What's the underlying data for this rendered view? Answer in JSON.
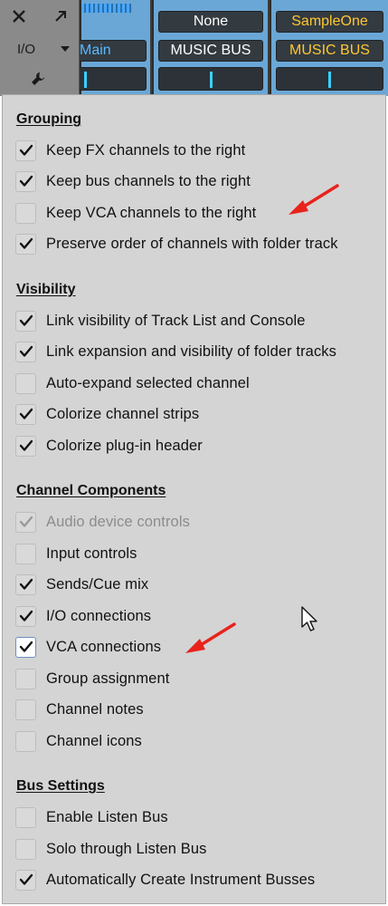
{
  "console": {
    "controls": {
      "close_icon": "close-x-icon",
      "expand_icon": "diagonal-arrow-icon",
      "io_label": "I/O",
      "io_arrow_icon": "triangle-down-icon",
      "wrench_icon": "wrench-icon"
    },
    "strips": [
      {
        "slot_b": "Main",
        "slot_b_color": "#5ab8ff"
      },
      {
        "slot_a": "None",
        "slot_b": "MUSIC BUS"
      },
      {
        "slot_a": "SampleOne",
        "slot_b": "MUSIC BUS",
        "accent": "#ffc832"
      }
    ]
  },
  "menu": {
    "sections": [
      {
        "title": "Grouping",
        "items": [
          {
            "label": "Keep FX channels to the right",
            "checked": true
          },
          {
            "label": "Keep bus channels to the right",
            "checked": true
          },
          {
            "label": "Keep VCA channels to the right",
            "checked": false
          },
          {
            "label": "Preserve order of channels with folder track",
            "checked": true
          }
        ]
      },
      {
        "title": "Visibility",
        "items": [
          {
            "label": "Link visibility of Track List and Console",
            "checked": true
          },
          {
            "label": "Link expansion and visibility of folder tracks",
            "checked": true
          },
          {
            "label": "Auto-expand selected channel",
            "checked": false
          },
          {
            "label": "Colorize channel strips",
            "checked": true
          },
          {
            "label": "Colorize plug-in header",
            "checked": true
          }
        ]
      },
      {
        "title": "Channel Components",
        "items": [
          {
            "label": "Audio device controls",
            "checked": true,
            "disabled": true
          },
          {
            "label": "Input controls",
            "checked": false
          },
          {
            "label": "Sends/Cue mix",
            "checked": true
          },
          {
            "label": "I/O connections",
            "checked": true
          },
          {
            "label": "VCA connections",
            "checked": true,
            "focused": true
          },
          {
            "label": "Group assignment",
            "checked": false
          },
          {
            "label": "Channel notes",
            "checked": false
          },
          {
            "label": "Channel icons",
            "checked": false
          }
        ]
      },
      {
        "title": "Bus Settings",
        "items": [
          {
            "label": "Enable Listen Bus",
            "checked": false
          },
          {
            "label": "Solo through Listen Bus",
            "checked": false
          },
          {
            "label": "Automatically Create Instrument Busses",
            "checked": true
          }
        ]
      }
    ]
  },
  "annotations": {
    "arrow_color": "#e8231c",
    "arrow_icon": "red-arrow-icon",
    "cursor_icon": "mouse-pointer-icon"
  }
}
